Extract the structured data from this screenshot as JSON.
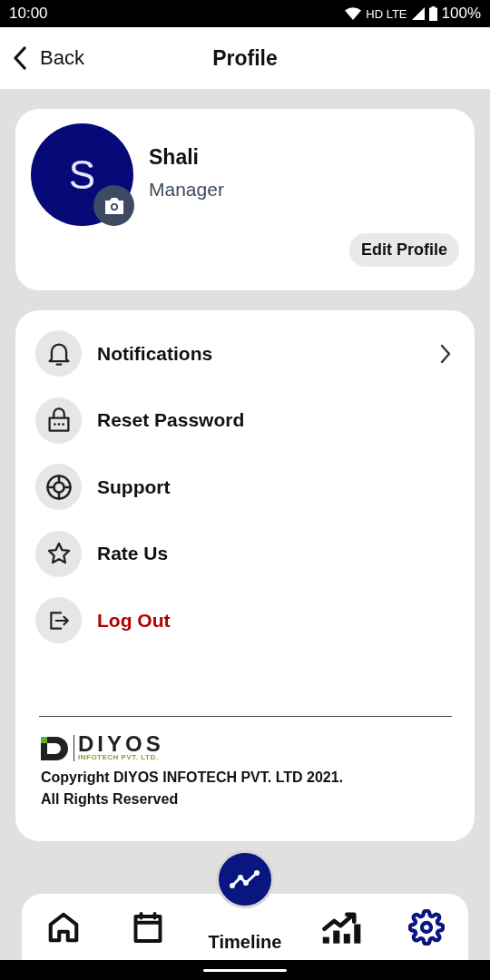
{
  "status_bar": {
    "time": "10:00",
    "network": "HD LTE",
    "battery": "100%"
  },
  "header": {
    "back": "Back",
    "title": "Profile"
  },
  "profile": {
    "initial": "S",
    "name": "Shali",
    "role": "Manager",
    "edit_button": "Edit Profile"
  },
  "menu": [
    {
      "kind": "bell",
      "label": "Notifications",
      "danger": false,
      "chevron": true
    },
    {
      "kind": "lock",
      "label": "Reset Password",
      "danger": false,
      "chevron": false
    },
    {
      "kind": "lifebuoy",
      "label": "Support",
      "danger": false,
      "chevron": false
    },
    {
      "kind": "star",
      "label": "Rate Us",
      "danger": false,
      "chevron": false
    },
    {
      "kind": "logout",
      "label": "Log Out",
      "danger": true,
      "chevron": false
    }
  ],
  "footer": {
    "logo_name": "DIYOS",
    "logo_tagline": "INFOTECH PVT. LTD.",
    "copyright": "Copyright DIYOS INFOTECH PVT. LTD 2021.",
    "rights": "All Rights Reserved"
  },
  "bottom_nav": [
    {
      "kind": "home",
      "selected": false
    },
    {
      "kind": "calendar",
      "selected": false
    },
    {
      "kind": "timeline",
      "label": "Timeline",
      "selected": false
    },
    {
      "kind": "growth",
      "selected": false
    },
    {
      "kind": "settings",
      "selected": true
    }
  ]
}
